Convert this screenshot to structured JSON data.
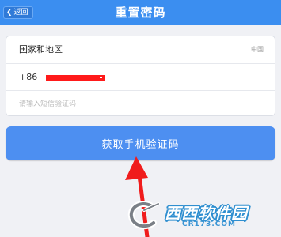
{
  "header": {
    "back_label": "返回",
    "title": "重置密码",
    "bg_color": "#3b8ef0"
  },
  "form": {
    "region_label": "国家和地区",
    "region_value": "中国",
    "phone_prefix": "+86",
    "code_placeholder": "请输入短信验证码"
  },
  "actions": {
    "get_code_label": "获取手机验证码",
    "button_color": "#4d8ff1"
  },
  "watermark": {
    "text": "西西软件园",
    "domain": "CR173.COM"
  },
  "icons": [
    "chevron-left-icon",
    "red-arrow-icon",
    "watermark-logo-icon"
  ]
}
